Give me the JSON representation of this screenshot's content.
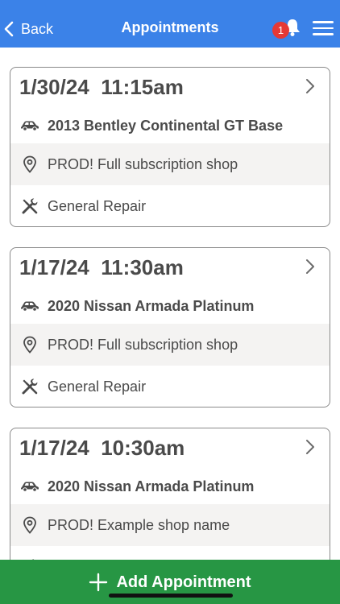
{
  "header": {
    "back_label": "Back",
    "title": "Appointments",
    "notification_count": "1",
    "colors": {
      "background": "#3b82e8",
      "badge": "#e53935"
    }
  },
  "appointments": [
    {
      "datetime": "1/30/24  11:15am",
      "vehicle": "2013 Bentley Continental GT Base",
      "shop": "PROD! Full subscription shop",
      "service": "General Repair"
    },
    {
      "datetime": "1/17/24  11:30am",
      "vehicle": "2020 Nissan Armada Platinum",
      "shop": "PROD! Full subscription shop",
      "service": "General Repair"
    },
    {
      "datetime": "1/17/24  10:30am",
      "vehicle": "2020 Nissan Armada Platinum",
      "shop": "PROD! Example shop name",
      "service": ""
    }
  ],
  "icons": {
    "vehicle": "car-icon",
    "shop": "location-pin-icon",
    "service": "tools-icon",
    "open": "chevron-right-icon"
  },
  "footer": {
    "add_label": "Add Appointment",
    "color": "#279644"
  }
}
